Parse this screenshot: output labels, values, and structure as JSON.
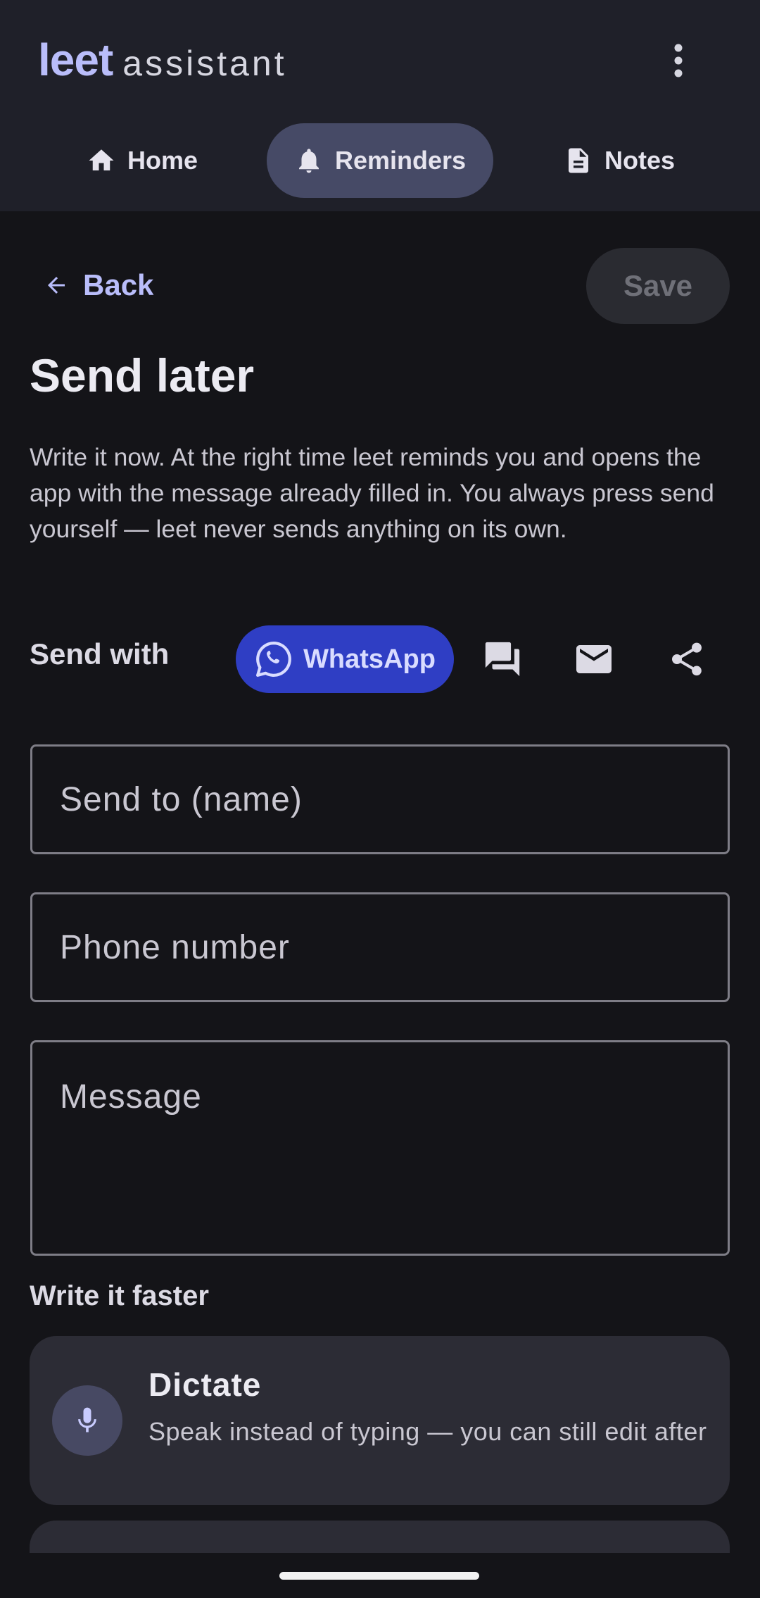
{
  "header": {
    "brand_bold": "leet",
    "brand_light": "assistant",
    "menu_icon": "more-vert-icon"
  },
  "tabs": [
    {
      "label": "Home",
      "icon": "home-icon",
      "active": false
    },
    {
      "label": "Reminders",
      "icon": "bell-icon",
      "active": true
    },
    {
      "label": "Notes",
      "icon": "document-icon",
      "active": false
    }
  ],
  "toolbar": {
    "back_label": "Back",
    "save_label": "Save"
  },
  "page": {
    "title": "Send later",
    "description": "Write it now. At the right time leet reminds you and opens the app with the message already filled in. You always press send yourself — leet never sends anything on its own."
  },
  "send_with": {
    "label": "Send with",
    "selected": "WhatsApp",
    "options": [
      {
        "name": "WhatsApp",
        "icon": "whatsapp-icon"
      },
      {
        "name": "sms",
        "icon": "chat-bubbles-icon"
      },
      {
        "name": "email",
        "icon": "mail-icon"
      },
      {
        "name": "share",
        "icon": "share-icon"
      }
    ]
  },
  "form": {
    "name_placeholder": "Send to (name)",
    "phone_placeholder": "Phone number",
    "message_placeholder": "Message"
  },
  "write_faster": {
    "label": "Write it faster",
    "dictate_title": "Dictate",
    "dictate_subtitle": "Speak instead of typing — you can still edit after"
  },
  "colors": {
    "accent": "#b9bdfa",
    "chip_active": "#2f3ec4",
    "tab_active": "#464a66",
    "background": "#141418",
    "header": "#1f2029",
    "card": "#2c2c35"
  }
}
